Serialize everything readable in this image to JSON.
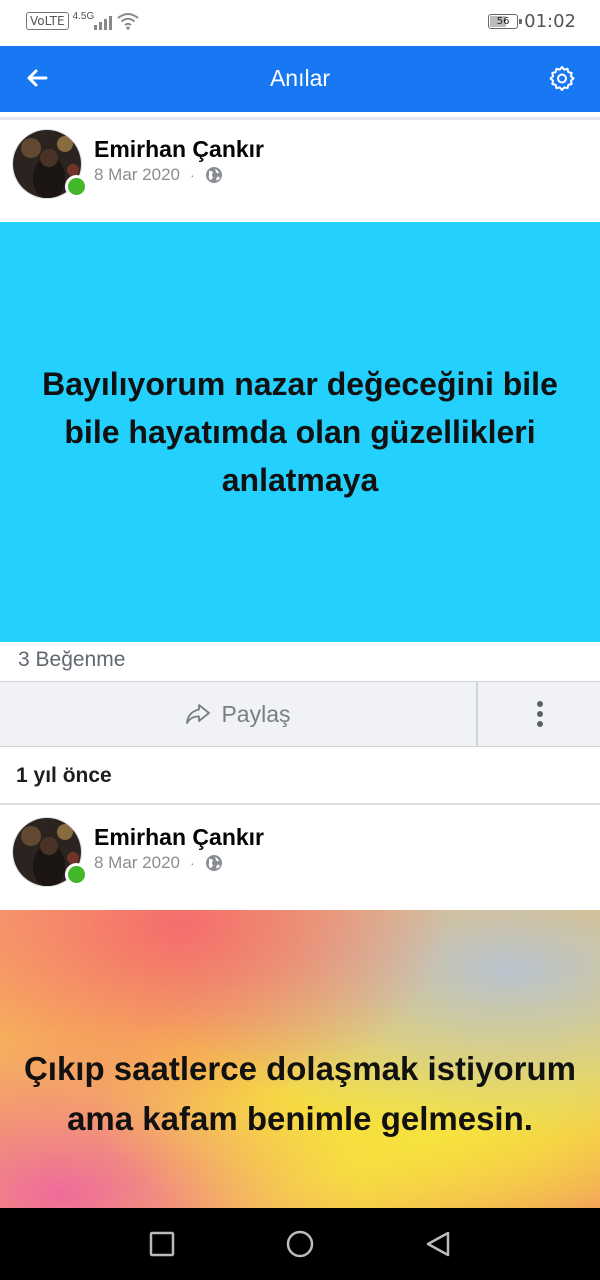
{
  "status_bar": {
    "volte": "VoLTE",
    "network": "4.5G",
    "battery": "56",
    "battery_level": 0.56,
    "time": "01:02"
  },
  "app_bar": {
    "title": "Anılar",
    "back_icon": "arrow-left-icon",
    "settings_icon": "gear-icon",
    "color": "#1877f2"
  },
  "posts": [
    {
      "author": "Emirhan Çankır",
      "date": "8 Mar 2020",
      "separator": "·",
      "privacy_icon": "globe-icon",
      "text": "Bayılıyorum nazar değeceğini bile bile hayatımda olan güzellikleri anlatmaya",
      "background": "#24d0fd",
      "likes": "3 Beğenme",
      "share_label": "Paylaş"
    },
    {
      "author": "Emirhan Çankır",
      "date": "8 Mar 2020",
      "separator": "·",
      "privacy_icon": "globe-icon",
      "text": "Çıkıp saatlerce dolaşmak istiyorum ama kafam benimle gelmesin."
    }
  ],
  "section_label": "1 yıl önce",
  "nav_bar": {
    "recent_icon": "square-icon",
    "home_icon": "circle-icon",
    "back_icon": "triangle-back-icon"
  }
}
